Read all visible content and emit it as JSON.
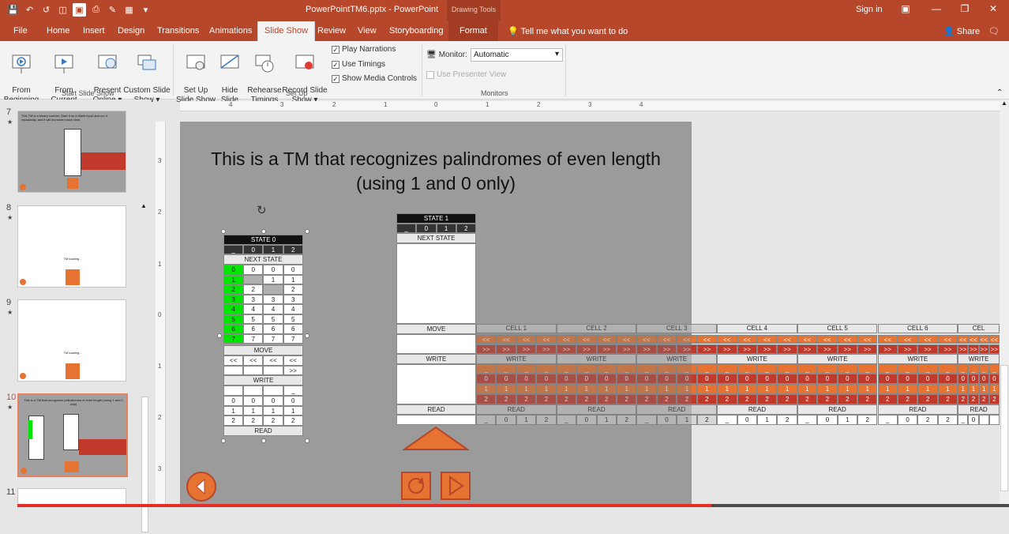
{
  "window": {
    "title": "PowerPointTM6.pptx - PowerPoint",
    "contextual": "Drawing Tools",
    "sign_in": "Sign in",
    "colors": {
      "brand": "#b7472a",
      "highlight": "#00e600",
      "orange": "#e67332",
      "red": "#c0392b"
    }
  },
  "qat": {
    "icons": [
      "save-icon",
      "undo-icon",
      "redo-icon",
      "present-icon",
      "slideshow-icon",
      "print-icon",
      "pen-icon",
      "format-icon",
      "dropdown-icon"
    ]
  },
  "tabs": [
    "File",
    "Home",
    "Insert",
    "Design",
    "Transitions",
    "Animations",
    "Slide Show",
    "Review",
    "View",
    "Storyboarding",
    "Format"
  ],
  "active_tab": "Slide Show",
  "tell_me": "Tell me what you want to do",
  "share": "Share",
  "ribbon": {
    "from_beginning": "From\nBeginning",
    "from_current": "From\nCurrent Slide",
    "present_online": "Present\nOnline ▾",
    "custom_show": "Custom Slide\nShow ▾",
    "group_start": "Start Slide Show",
    "setup_show": "Set Up\nSlide Show",
    "hide_slide": "Hide\nSlide",
    "rehearse": "Rehearse\nTimings",
    "record": "Record Slide\nShow ▾",
    "play_narrations": "Play Narrations",
    "use_timings": "Use Timings",
    "show_media": "Show Media Controls",
    "group_setup": "Set Up",
    "monitor_label": "Monitor:",
    "monitor_value": "Automatic",
    "presenter_view": "Use Presenter View",
    "group_monitors": "Monitors"
  },
  "slides": [
    {
      "num": "7",
      "text": "This TM is a binary counter. Start it on a blank input and run it repeatedly, and it will increment each time."
    },
    {
      "num": "8",
      "text": "TM loading..."
    },
    {
      "num": "9",
      "text": "TM loading..."
    },
    {
      "num": "10",
      "text": "This is a TM that recognizes palindromes of even length (using 1 and 0 only)"
    },
    {
      "num": "11",
      "text": ""
    }
  ],
  "rulers": {
    "h": [
      "4",
      "3",
      "2",
      "1",
      "0",
      "1",
      "2",
      "3",
      "4"
    ],
    "v": [
      "3",
      "2",
      "1",
      "0",
      "1",
      "2",
      "3"
    ]
  },
  "slide": {
    "title_line1": "This is a TM that recognizes palindromes of even length",
    "title_line2": "(using 1 and 0 only)",
    "state0": {
      "title": "STATE 0",
      "symbols": [
        "_",
        "0",
        "1",
        "2"
      ],
      "next_label": "NEXT STATE",
      "next_rows": [
        [
          "0",
          "0",
          "0",
          "0"
        ],
        [
          "1",
          "",
          "1",
          "1"
        ],
        [
          "2",
          "2",
          "",
          "2"
        ],
        [
          "3",
          "3",
          "3",
          "3"
        ],
        [
          "4",
          "4",
          "4",
          "4"
        ],
        [
          "5",
          "5",
          "5",
          "5"
        ],
        [
          "6",
          "6",
          "6",
          "6"
        ],
        [
          "7",
          "7",
          "7",
          "7"
        ]
      ],
      "move_label": "MOVE",
      "move_rows": [
        [
          "<<",
          "<<",
          "<<",
          "<<"
        ],
        [
          "",
          "",
          "",
          ">>"
        ]
      ],
      "write_label": "WRITE",
      "write_rows": [
        [
          "",
          "",
          "",
          "_"
        ]
      ],
      "write_rows2": [
        [
          "0",
          "0",
          "0",
          "0"
        ],
        [
          "1",
          "1",
          "1",
          "1"
        ],
        [
          "2",
          "2",
          "2",
          "2"
        ]
      ],
      "read_label": "READ"
    },
    "state1": {
      "title": "STATE 1",
      "symbols": [
        "_",
        "0",
        "1",
        "2"
      ],
      "next_label": "NEXT STATE",
      "move_label": "MOVE",
      "write_label": "WRITE",
      "read_label": "READ"
    },
    "cells": [
      "CELL 1",
      "CELL 2",
      "CELL 3",
      "CELL 4",
      "CELL 5",
      "CELL 6",
      "CEL"
    ],
    "cell_write_label": "WRITE",
    "cell_read_label": "READ",
    "move_left": "<<",
    "move_right": ">>",
    "rows": {
      "blank": "_",
      "zero": "0",
      "one": "1",
      "two": "2"
    },
    "read_values": [
      [
        "_",
        "0",
        "1",
        "2"
      ],
      [
        "_",
        "0",
        "1",
        "2"
      ],
      [
        "_",
        "0",
        "1",
        "2"
      ],
      [
        "_",
        "0",
        "1",
        "2"
      ],
      [
        "_",
        "0",
        "1",
        "2"
      ],
      [
        "_",
        "0",
        "2",
        "2"
      ],
      [
        "_",
        "0",
        "",
        ""
      ]
    ]
  },
  "progress": 0.7
}
